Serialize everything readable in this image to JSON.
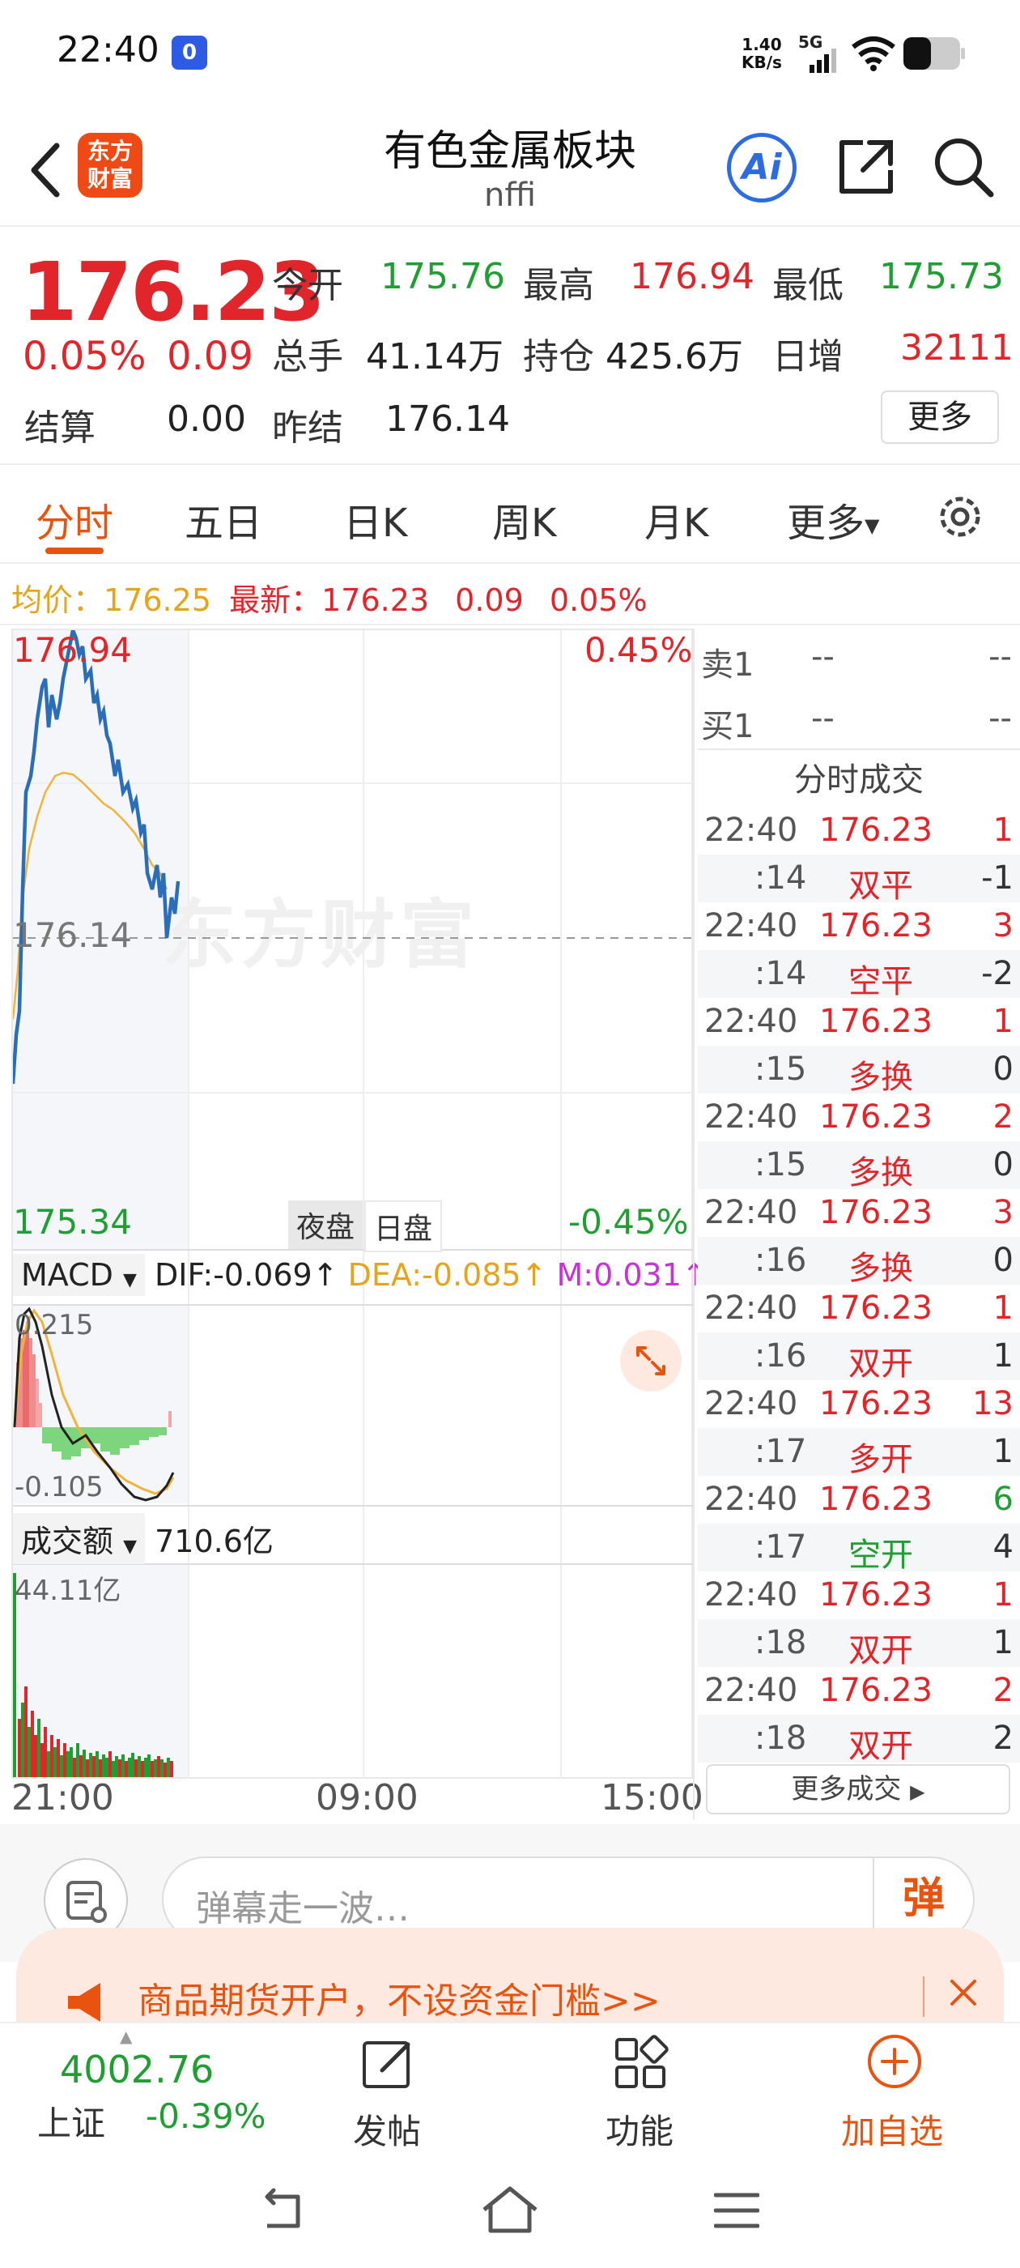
{
  "status_bar": {
    "time": "22:40",
    "net_speed": "1.40",
    "net_unit": "KB/s",
    "signal": "5G"
  },
  "header": {
    "logo_text": "东方财富",
    "title": "有色金属板块",
    "subtitle": "nffi",
    "ai_label": "Ai"
  },
  "quote": {
    "price": "176.23",
    "change_pct": "0.05%",
    "change": "0.09",
    "open_label": "今开",
    "open": "175.76",
    "high_label": "最高",
    "high": "176.94",
    "low_label": "最低",
    "low": "175.73",
    "volume_label": "总手",
    "volume": "41.14万",
    "oi_label": "持仓",
    "oi": "425.6万",
    "daily_inc_label": "日增",
    "daily_inc": "32111",
    "settle_label": "结算",
    "settle": "0.00",
    "prev_settle_label": "昨结",
    "prev_settle": "176.14",
    "more": "更多"
  },
  "tabs": [
    {
      "label": "分时",
      "active": true
    },
    {
      "label": "五日"
    },
    {
      "label": "日K"
    },
    {
      "label": "周K"
    },
    {
      "label": "月K"
    },
    {
      "label": "更多"
    }
  ],
  "info_line": {
    "avg_label": "均价：",
    "avg": "176.25",
    "latest_label": "最新：",
    "latest": "176.23",
    "chg": "0.09",
    "chg_pct": "0.05%"
  },
  "chart": {
    "top_price": "176.94",
    "top_pct": "0.45%",
    "mid_price": "176.14",
    "bottom_price": "175.34",
    "bottom_pct": "-0.45%",
    "night_label": "夜盘",
    "day_label": "日盘",
    "watermark": "东方财富",
    "macd": {
      "label": "MACD",
      "dif": "DIF:-0.069",
      "dea": "DEA:-0.085",
      "m": "M:0.031",
      "top": "0.215",
      "bottom": "-0.105"
    },
    "turnover": {
      "label": "成交额",
      "value": "710.6亿",
      "max": "44.11亿"
    },
    "times": [
      "21:00",
      "09:00",
      "15:00"
    ],
    "colors": {
      "price_line": "#2a6db8",
      "avg_line": "#f0b43a",
      "up": "#e0262b",
      "down": "#1f9e32"
    }
  },
  "order_book": {
    "sell_label": "卖1",
    "sell_price": "--",
    "sell_vol": "--",
    "buy_label": "买1",
    "buy_price": "--",
    "buy_vol": "--"
  },
  "ticks": {
    "title": "分时成交",
    "rows": [
      {
        "time": "22:40",
        "price": "176.23",
        "vol": "1",
        "vol_color": "red"
      },
      {
        "time": ":14",
        "type": "双平",
        "oi": "-1",
        "type_color": "red"
      },
      {
        "time": "22:40",
        "price": "176.23",
        "vol": "3",
        "vol_color": "red"
      },
      {
        "time": ":14",
        "type": "空平",
        "oi": "-2",
        "type_color": "red"
      },
      {
        "time": "22:40",
        "price": "176.23",
        "vol": "1",
        "vol_color": "red"
      },
      {
        "time": ":15",
        "type": "多换",
        "oi": "0",
        "type_color": "red"
      },
      {
        "time": "22:40",
        "price": "176.23",
        "vol": "2",
        "vol_color": "red"
      },
      {
        "time": ":15",
        "type": "多换",
        "oi": "0",
        "type_color": "red"
      },
      {
        "time": "22:40",
        "price": "176.23",
        "vol": "3",
        "vol_color": "red"
      },
      {
        "time": ":16",
        "type": "多换",
        "oi": "0",
        "type_color": "red"
      },
      {
        "time": "22:40",
        "price": "176.23",
        "vol": "1",
        "vol_color": "red"
      },
      {
        "time": ":16",
        "type": "双开",
        "oi": "1",
        "type_color": "red"
      },
      {
        "time": "22:40",
        "price": "176.23",
        "vol": "13",
        "vol_color": "red"
      },
      {
        "time": ":17",
        "type": "多开",
        "oi": "1",
        "type_color": "red"
      },
      {
        "time": "22:40",
        "price": "176.23",
        "vol": "6",
        "vol_color": "green"
      },
      {
        "time": ":17",
        "type": "空开",
        "oi": "4",
        "type_color": "green"
      },
      {
        "time": "22:40",
        "price": "176.23",
        "vol": "1",
        "vol_color": "red"
      },
      {
        "time": ":18",
        "type": "双开",
        "oi": "1",
        "type_color": "red"
      },
      {
        "time": "22:40",
        "price": "176.23",
        "vol": "2",
        "vol_color": "red"
      },
      {
        "time": ":18",
        "type": "双开",
        "oi": "2",
        "type_color": "red"
      }
    ],
    "more": "更多成交"
  },
  "comment": {
    "placeholder": "弹幕走一波…",
    "danmu": "弹"
  },
  "banner": {
    "text": "商品期货开户，不设资金门槛>>"
  },
  "toolbar": {
    "index_value": "4002.76",
    "index_name": "上证",
    "index_change": "-0.39%",
    "post": "发帖",
    "functions": "功能",
    "add_watch": "加自选"
  }
}
